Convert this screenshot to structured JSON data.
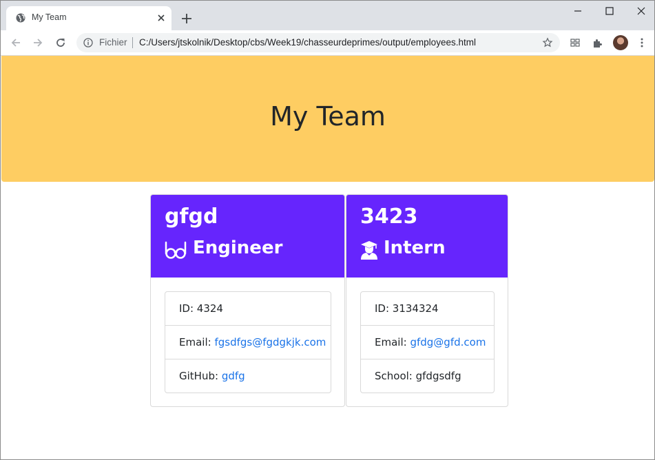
{
  "browser": {
    "tab_title": "My Team",
    "scheme_label": "Fichier",
    "url": "C:/Users/jtskolnik/Desktop/cbs/Week19/chasseurdeprimes/output/employees.html"
  },
  "page": {
    "title": "My Team"
  },
  "employees": [
    {
      "name": "gfgd",
      "role": "Engineer",
      "role_icon": "glasses-icon",
      "id_label": "ID: ",
      "id": "4324",
      "email_label": "Email: ",
      "email": "fgsdfgs@fgdgkjk.com",
      "extra_label": "GitHub: ",
      "extra": "gdfg"
    },
    {
      "name": "3423",
      "role": "Intern",
      "role_icon": "graduate-icon",
      "id_label": "ID: ",
      "id": "3134324",
      "email_label": "Email: ",
      "email": "gfdg@gfd.com",
      "extra_label": "School: ",
      "extra": "gfdgsdfg"
    }
  ],
  "colors": {
    "jumbotron": "#fecd62",
    "card_header": "#6625fd",
    "link": "#1a73e8"
  }
}
